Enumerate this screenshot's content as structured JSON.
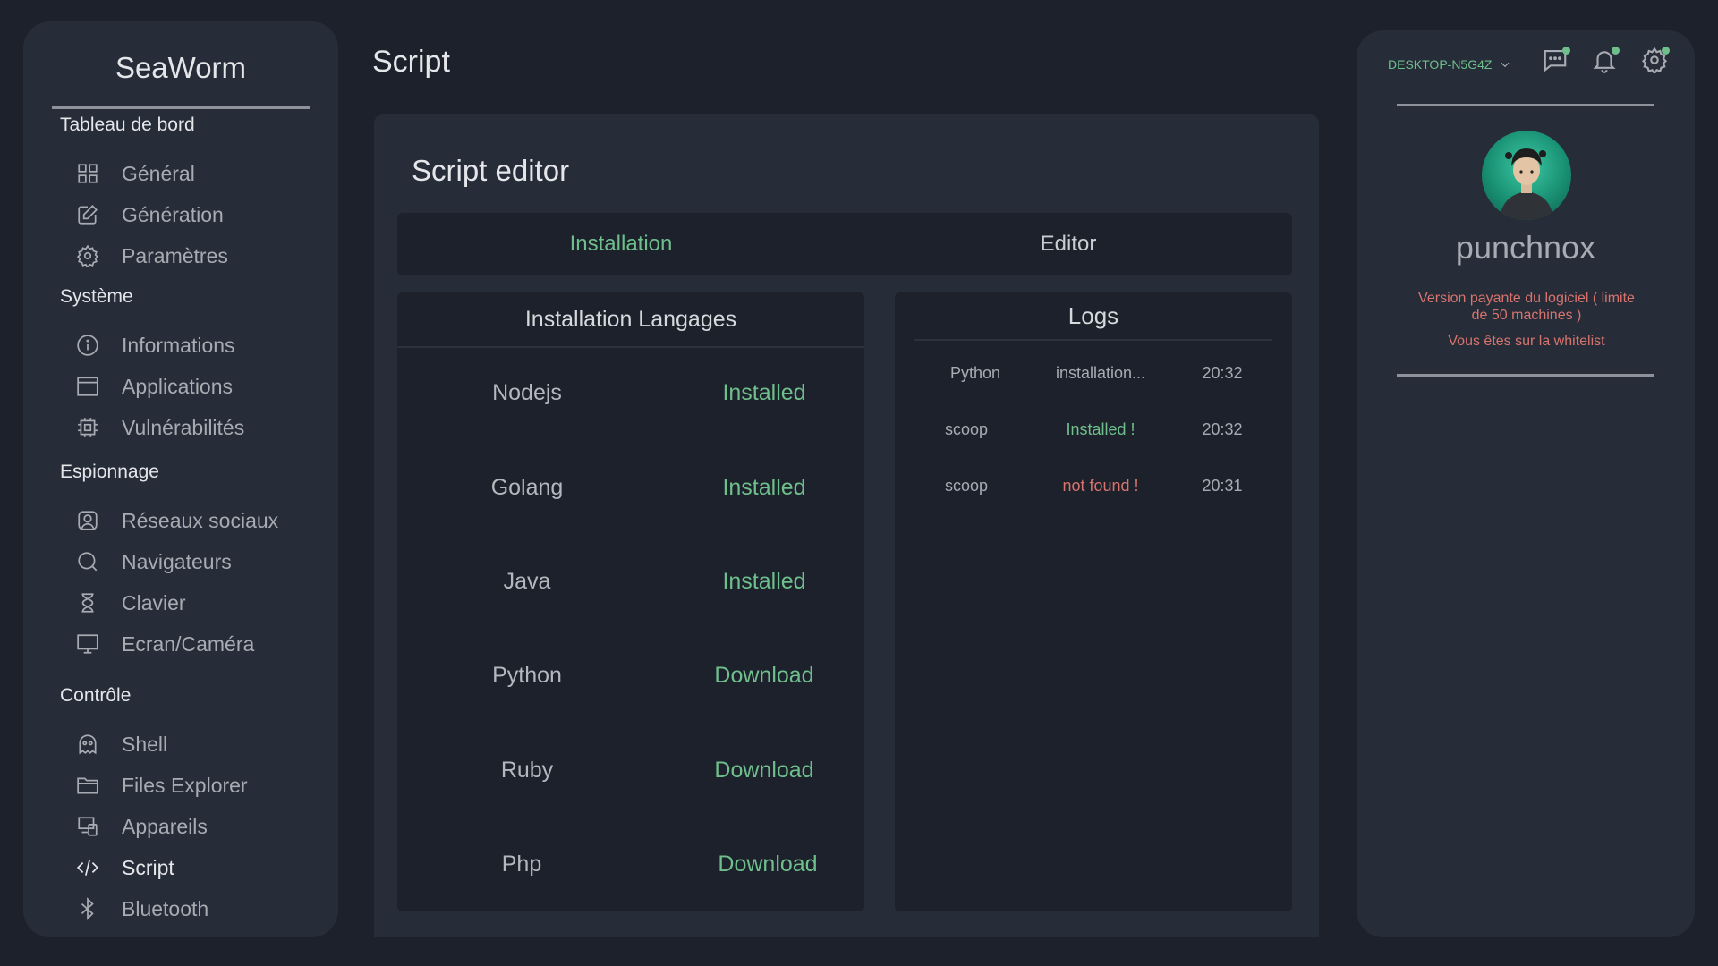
{
  "app": {
    "brand": "SeaWorm"
  },
  "sidebar": {
    "sections": [
      {
        "title": "Tableau de bord",
        "items": [
          {
            "label": "Général",
            "icon": "grid-icon"
          },
          {
            "label": "Génération",
            "icon": "pencil-icon"
          },
          {
            "label": "Paramètres",
            "icon": "gear-icon"
          }
        ]
      },
      {
        "title": "Système",
        "items": [
          {
            "label": "Informations",
            "icon": "info-icon"
          },
          {
            "label": "Applications",
            "icon": "window-icon"
          },
          {
            "label": "Vulnérabilités",
            "icon": "chip-icon"
          }
        ]
      },
      {
        "title": "Espionnage",
        "items": [
          {
            "label": "Réseaux sociaux",
            "icon": "user-icon"
          },
          {
            "label": "Navigateurs",
            "icon": "search-icon"
          },
          {
            "label": "Clavier",
            "icon": "hourglass-icon"
          },
          {
            "label": "Ecran/Caméra",
            "icon": "monitor-icon"
          }
        ]
      },
      {
        "title": "Contrôle",
        "items": [
          {
            "label": "Shell",
            "icon": "ghost-icon"
          },
          {
            "label": "Files Explorer",
            "icon": "folder-icon"
          },
          {
            "label": "Appareils",
            "icon": "devices-icon"
          },
          {
            "label": "Script",
            "icon": "code-icon",
            "active": true
          },
          {
            "label": "Bluetooth",
            "icon": "bluetooth-icon"
          }
        ]
      }
    ]
  },
  "page": {
    "title": "Script"
  },
  "editor": {
    "title": "Script editor",
    "tabs": [
      {
        "label": "Installation",
        "active": true
      },
      {
        "label": "Editor",
        "active": false
      }
    ]
  },
  "installation": {
    "header": "Installation Langages",
    "rows": [
      {
        "name": "Nodejs",
        "status": "Installed"
      },
      {
        "name": "Golang",
        "status": "Installed"
      },
      {
        "name": "Java",
        "status": "Installed"
      },
      {
        "name": "Python",
        "status": "Download"
      },
      {
        "name": "Ruby",
        "status": "Download"
      },
      {
        "name": "Php",
        "status": "Download"
      }
    ]
  },
  "logs": {
    "header": "Logs",
    "rows": [
      {
        "name": "Python",
        "message": "installation...",
        "time": "20:32",
        "color": "#a7abb2"
      },
      {
        "name": "scoop",
        "message": "Installed !",
        "time": "20:32",
        "color": "#6fbf8c"
      },
      {
        "name": "scoop",
        "message": "not found !",
        "time": "20:31",
        "color": "#d8746e"
      }
    ]
  },
  "profile": {
    "machine": "DESKTOP-N5G4Z",
    "username": "punchnox",
    "license_line1": "Version payante du logiciel ( limite",
    "license_line2": "de 50 machines )",
    "whitelist": "Vous êtes sur la whitelist"
  },
  "colors": {
    "accent": "#6fbf8c",
    "error": "#d8746e",
    "panel": "#262c38",
    "background": "#1c212b"
  }
}
